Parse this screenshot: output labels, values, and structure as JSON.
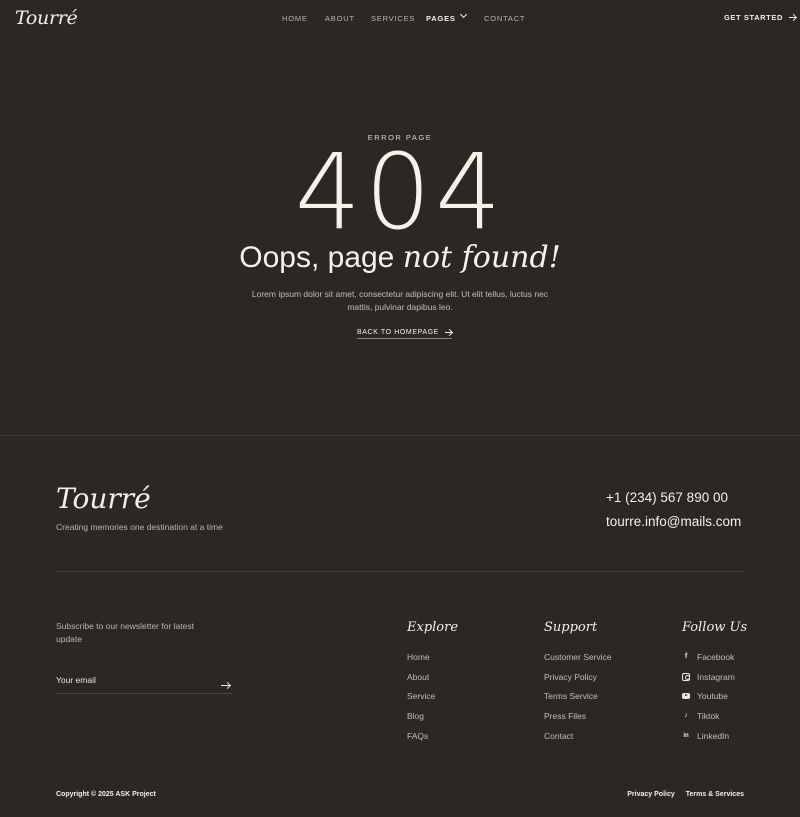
{
  "brand": {
    "logo": "Tourré"
  },
  "nav": {
    "items": [
      {
        "label": "HOME"
      },
      {
        "label": "ABOUT"
      },
      {
        "label": "SERVICES"
      },
      {
        "label": "PAGES"
      },
      {
        "label": "CONTACT"
      }
    ],
    "cta": "GET STARTED"
  },
  "hero": {
    "eyebrow": "ERROR PAGE",
    "code": "404",
    "headline_plain": "Oops, page ",
    "headline_italic": "not found!",
    "description": "Lorem ipsum dolor sit amet, consectetur adipiscing elit. Ut elit tellus, luctus nec mattis, pulvinar dapibus leo.",
    "back_label": "BACK TO HOMEPAGE"
  },
  "footer": {
    "logo": "Tourré",
    "tagline": "Creating memories one destination at a time",
    "phone": "+1 (234) 567 890 00",
    "email": "tourre.info@mails.com",
    "newsletter_text": "Subscribe to our newsletter for latest update",
    "email_placeholder": "Your email",
    "columns": [
      {
        "title": "Explore",
        "links": [
          "Home",
          "About",
          "Service",
          "Blog",
          "FAQs"
        ]
      },
      {
        "title": "Support",
        "links": [
          "Customer Service",
          "Privacy Policy",
          "Terms Service",
          "Press Files",
          "Contact"
        ]
      },
      {
        "title": "Follow Us",
        "links": [
          "Facebook",
          "Instagram",
          "Youtube",
          "Tiktok",
          "LinkedIn"
        ]
      }
    ],
    "social_icons": [
      "facebook-icon",
      "instagram-icon",
      "youtube-icon",
      "tiktok-icon",
      "linkedin-icon"
    ],
    "copyright": "Copyright © 2025 ASK Project",
    "legal": [
      "Privacy Policy",
      "Terms & Services"
    ]
  },
  "colors": {
    "background": "#2b2824",
    "text": "#ece8e1",
    "muted": "#b9b4ac"
  }
}
